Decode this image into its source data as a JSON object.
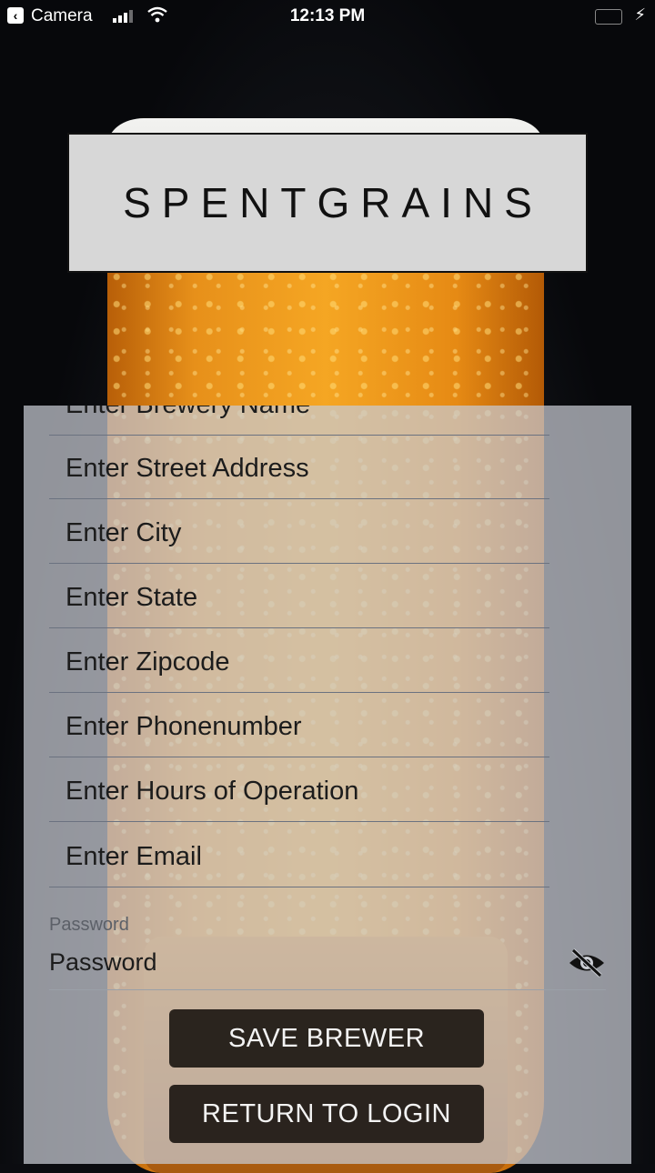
{
  "status_bar": {
    "back_app": "Camera",
    "time": "12:13 PM",
    "battery_color": "#4cd964"
  },
  "brand": {
    "logo_text": "SPENTGRAINS"
  },
  "form": {
    "fields": [
      {
        "placeholder": "Enter Brewery Name"
      },
      {
        "placeholder": "Enter Street Address"
      },
      {
        "placeholder": "Enter City"
      },
      {
        "placeholder": "Enter State"
      },
      {
        "placeholder": "Enter Zipcode"
      },
      {
        "placeholder": "Enter Phonenumber"
      },
      {
        "placeholder": "Enter Hours of Operation"
      },
      {
        "placeholder": "Enter Email"
      }
    ],
    "password": {
      "label": "Password",
      "placeholder": "Password",
      "toggle_icon": "eye-off-icon"
    }
  },
  "buttons": {
    "save": "SAVE BREWER",
    "return": "RETURN TO LOGIN"
  }
}
